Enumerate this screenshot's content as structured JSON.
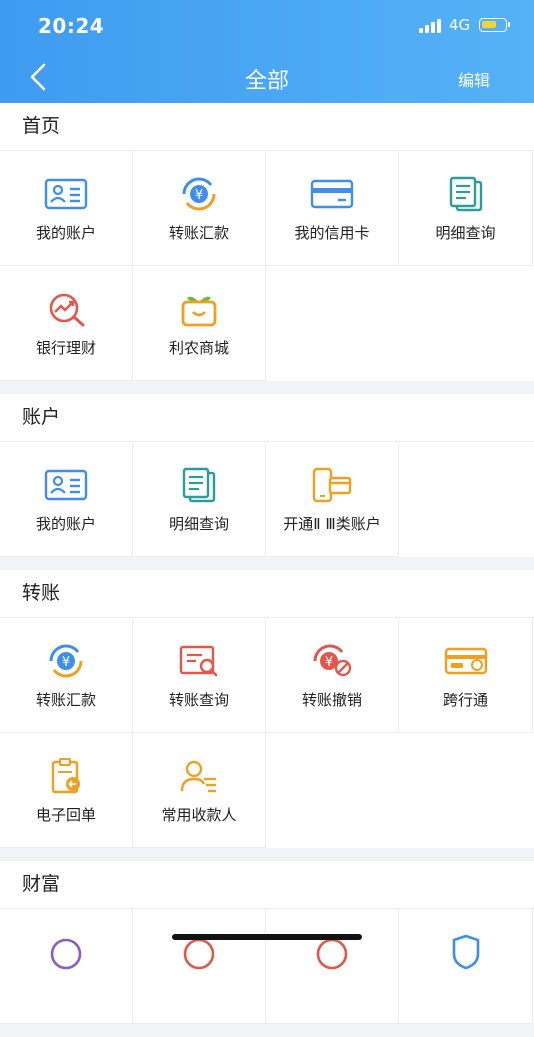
{
  "status_bar": {
    "time": "20:24",
    "network": "4G"
  },
  "nav": {
    "title": "全部",
    "edit_label": "编辑"
  },
  "sections": [
    {
      "title": "首页",
      "items": [
        {
          "label": "我的账户",
          "icon": "account-card-icon"
        },
        {
          "label": "转账汇款",
          "icon": "transfer-yuan-icon"
        },
        {
          "label": "我的信用卡",
          "icon": "credit-card-icon"
        },
        {
          "label": "明细查询",
          "icon": "detail-docs-icon"
        },
        {
          "label": "银行理财",
          "icon": "finance-chart-icon"
        },
        {
          "label": "利农商城",
          "icon": "shopping-basket-icon"
        }
      ]
    },
    {
      "title": "账户",
      "items": [
        {
          "label": "我的账户",
          "icon": "account-card-icon"
        },
        {
          "label": "明细查询",
          "icon": "detail-docs-icon"
        },
        {
          "label": "开通Ⅱ Ⅲ类账户",
          "icon": "phone-card-icon"
        }
      ]
    },
    {
      "title": "转账",
      "items": [
        {
          "label": "转账汇款",
          "icon": "transfer-yuan-icon"
        },
        {
          "label": "转账查询",
          "icon": "transfer-search-icon"
        },
        {
          "label": "转账撤销",
          "icon": "transfer-cancel-icon"
        },
        {
          "label": "跨行通",
          "icon": "cross-bank-card-icon"
        },
        {
          "label": "电子回单",
          "icon": "e-receipt-icon"
        },
        {
          "label": "常用收款人",
          "icon": "payee-icon"
        }
      ]
    },
    {
      "title": "财富",
      "items": []
    }
  ],
  "colors": {
    "header_start": "#3f9bf0",
    "header_end": "#55b2f7",
    "blue": "#3f8ee8",
    "teal": "#2a9d9a",
    "red": "#e2574c",
    "orange": "#f0a020"
  }
}
